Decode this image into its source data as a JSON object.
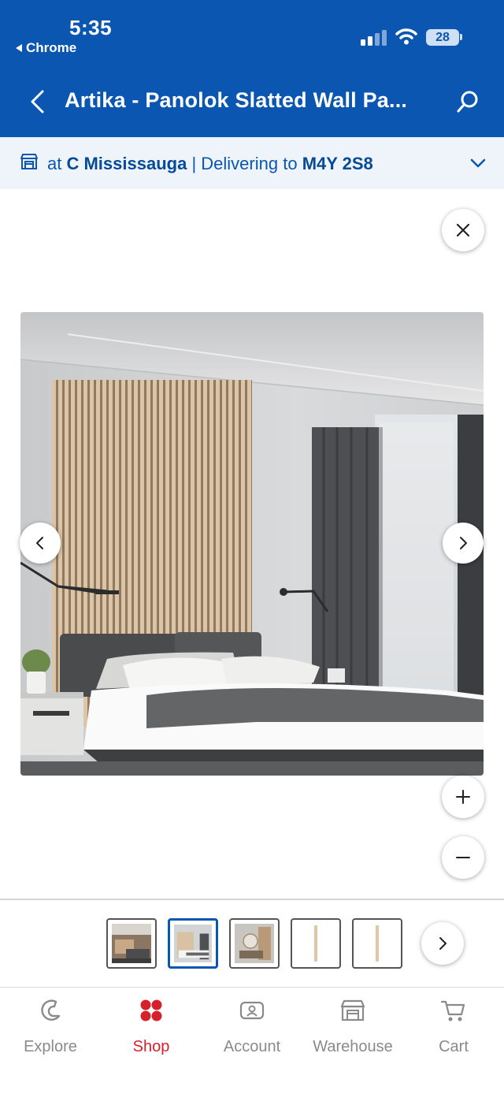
{
  "status": {
    "time": "5:35",
    "back_app": "Chrome",
    "battery": "28"
  },
  "header": {
    "title": "Artika - Panolok Slatted Wall Pa..."
  },
  "store_bar": {
    "prefix": "at",
    "store": "C Mississauga",
    "separator": "| Delivering to",
    "postal": "M4Y 2S8"
  },
  "viewer": {
    "thumbnail_count": 5,
    "selected_thumbnail": 2
  },
  "tabs": [
    {
      "label": "Explore",
      "icon": "explore-icon"
    },
    {
      "label": "Shop",
      "icon": "shop-icon",
      "active": true
    },
    {
      "label": "Account",
      "icon": "account-icon"
    },
    {
      "label": "Warehouse",
      "icon": "warehouse-icon"
    },
    {
      "label": "Cart",
      "icon": "cart-icon"
    }
  ],
  "colors": {
    "brand_blue": "#0a56b0",
    "active_red": "#d6202a",
    "store_bar_bg": "#eef4fa"
  }
}
